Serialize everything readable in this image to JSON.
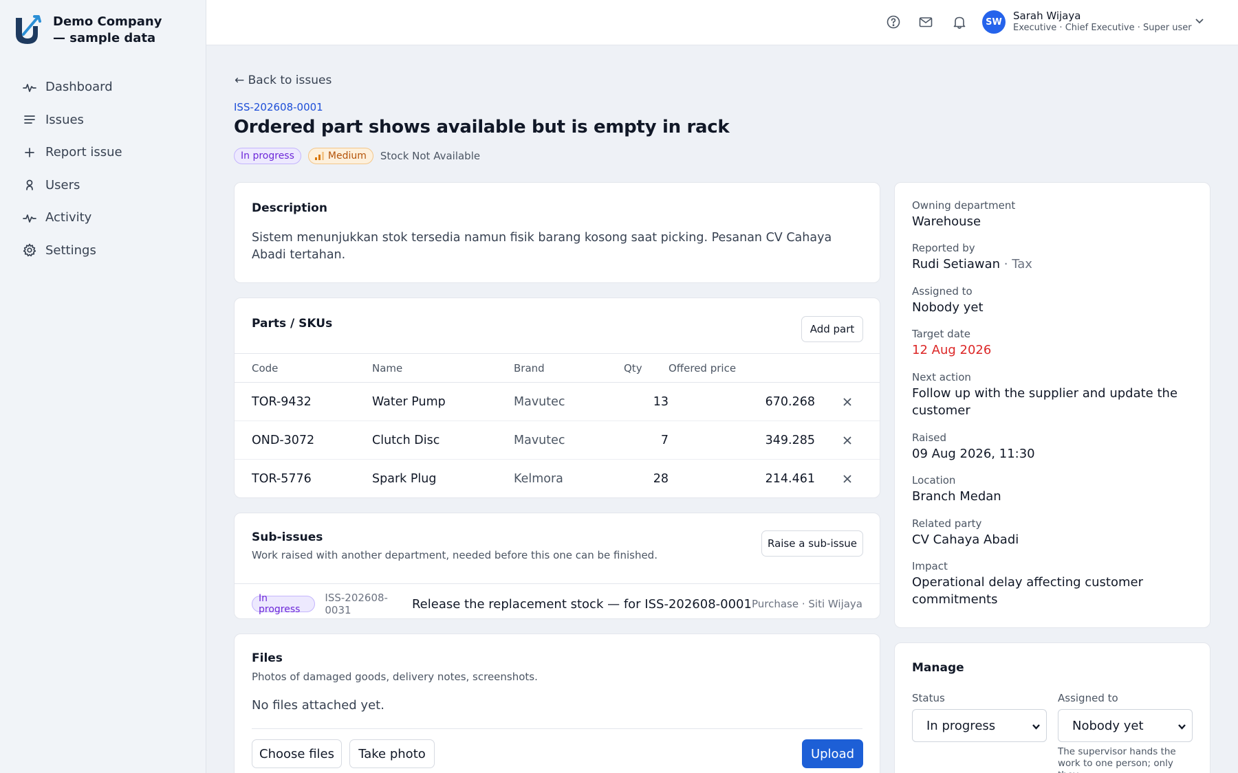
{
  "brand": {
    "name": "Demo Company — sample data",
    "accent": "#1d5fd6"
  },
  "nav": [
    {
      "label": "Dashboard",
      "icon": "pulse-icon"
    },
    {
      "label": "Issues",
      "icon": "list-icon"
    },
    {
      "label": "Report issue",
      "icon": "plus-icon"
    },
    {
      "label": "Users",
      "icon": "user-icon"
    },
    {
      "label": "Activity",
      "icon": "pulse-icon"
    },
    {
      "label": "Settings",
      "icon": "gear-icon"
    }
  ],
  "topbar": {
    "user_initials": "SW",
    "user_name": "Sarah Wijaya",
    "user_role": "Executive · Chief Executive · Super user"
  },
  "issue": {
    "back_label": "← Back to issues",
    "id": "ISS-202608-0001",
    "title": "Ordered part shows available but is empty in rack",
    "status": "In progress",
    "priority": "Medium",
    "category": "Stock Not Available"
  },
  "description": {
    "title": "Description",
    "text": "Sistem menunjukkan stok tersedia namun fisik barang kosong saat picking. Pesanan CV Cahaya Abadi tertahan."
  },
  "parts": {
    "title": "Parts / SKUs",
    "add_label": "Add part",
    "columns": {
      "code": "Code",
      "name": "Name",
      "brand": "Brand",
      "qty": "Qty",
      "price": "Offered price"
    },
    "rows": [
      {
        "code": "TOR-9432",
        "name": "Water Pump",
        "brand": "Mavutec",
        "qty": "13",
        "price": "670.268"
      },
      {
        "code": "OND-3072",
        "name": "Clutch Disc",
        "brand": "Mavutec",
        "qty": "7",
        "price": "349.285"
      },
      {
        "code": "TOR-5776",
        "name": "Spark Plug",
        "brand": "Kelmora",
        "qty": "28",
        "price": "214.461"
      }
    ]
  },
  "subissues": {
    "title": "Sub-issues",
    "subtitle": "Work raised with another department, needed before this one can be finished.",
    "raise_label": "Raise a sub-issue",
    "items": [
      {
        "status": "In progress",
        "id": "ISS-202608-0031",
        "title": "Release the replacement stock — for ISS-202608-0001",
        "meta": "Purchase · Siti Wijaya"
      }
    ]
  },
  "files": {
    "title": "Files",
    "subtitle": "Photos of damaged goods, delivery notes, screenshots.",
    "empty": "No files attached yet.",
    "choose_label": "Choose files",
    "photo_label": "Take photo",
    "upload_label": "Upload"
  },
  "details": {
    "owning_department_label": "Owning department",
    "owning_department": "Warehouse",
    "reported_by_label": "Reported by",
    "reported_by": "Rudi Setiawan",
    "reported_by_dept": "· Tax",
    "assigned_to_label": "Assigned to",
    "assigned_to": "Nobody yet",
    "target_date_label": "Target date",
    "target_date": "12 Aug 2026",
    "next_action_label": "Next action",
    "next_action": "Follow up with the supplier and update the customer",
    "raised_label": "Raised",
    "raised": "09 Aug 2026, 11:30",
    "location_label": "Location",
    "location": "Branch Medan",
    "related_party_label": "Related party",
    "related_party": "CV Cahaya Abadi",
    "impact_label": "Impact",
    "impact": "Operational delay affecting customer commitments"
  },
  "manage": {
    "title": "Manage",
    "status_label": "Status",
    "status_value": "In progress",
    "assigned_label": "Assigned to",
    "assigned_value": "Nobody yet",
    "assign_note": "The supervisor hands the work to one person; only they"
  }
}
